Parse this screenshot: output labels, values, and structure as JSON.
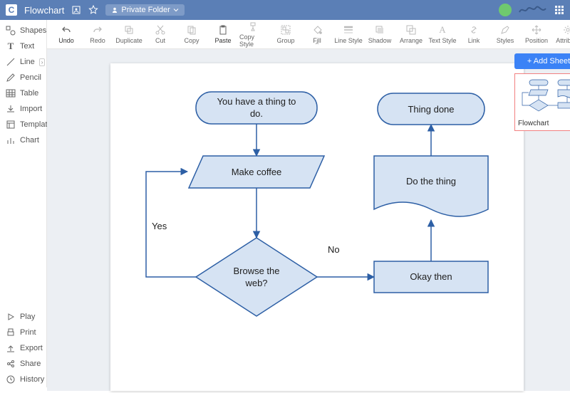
{
  "header": {
    "title": "Flowchart",
    "folder_label": "Private Folder"
  },
  "sidebar": {
    "top": [
      {
        "icon": "shapes",
        "label": "Shapes"
      },
      {
        "icon": "text",
        "label": "Text"
      },
      {
        "icon": "line",
        "label": "Line"
      },
      {
        "icon": "pencil",
        "label": "Pencil"
      },
      {
        "icon": "table",
        "label": "Table"
      },
      {
        "icon": "import",
        "label": "Import"
      },
      {
        "icon": "template",
        "label": "Template"
      },
      {
        "icon": "chart",
        "label": "Chart"
      }
    ],
    "bottom": [
      {
        "icon": "play",
        "label": "Play"
      },
      {
        "icon": "print",
        "label": "Print"
      },
      {
        "icon": "export",
        "label": "Export"
      },
      {
        "icon": "share",
        "label": "Share"
      },
      {
        "icon": "history",
        "label": "History"
      }
    ]
  },
  "toolbar": {
    "items": [
      {
        "id": "undo",
        "label": "Undo"
      },
      {
        "id": "redo",
        "label": "Redo"
      },
      {
        "id": "duplicate",
        "label": "Duplicate"
      },
      {
        "id": "cut",
        "label": "Cut"
      },
      {
        "id": "copy",
        "label": "Copy"
      },
      {
        "id": "paste",
        "label": "Paste"
      },
      {
        "id": "copystyle",
        "label": "Copy Style"
      },
      {
        "id": "group",
        "label": "Group"
      },
      {
        "id": "fill",
        "label": "Fill"
      },
      {
        "id": "linestyle",
        "label": "Line Style"
      },
      {
        "id": "shadow",
        "label": "Shadow"
      },
      {
        "id": "arrange",
        "label": "Arrange"
      },
      {
        "id": "textstyle",
        "label": "Text Style"
      },
      {
        "id": "link",
        "label": "Link"
      },
      {
        "id": "styles",
        "label": "Styles"
      },
      {
        "id": "position",
        "label": "Position"
      },
      {
        "id": "attribute",
        "label": "Attribute"
      }
    ],
    "add_sheet_label": "+ Add Sheet"
  },
  "thumbnail": {
    "label": "Flowchart"
  },
  "flowchart": {
    "nodes": {
      "start": {
        "line1": "You have a thing to",
        "line2": "do."
      },
      "coffee": "Make coffee",
      "browse": {
        "line1": "Browse the",
        "line2": "web?"
      },
      "okay": "Okay then",
      "dothing": "Do the thing",
      "done": "Thing done"
    },
    "edges": {
      "yes": "Yes",
      "no": "No"
    }
  }
}
